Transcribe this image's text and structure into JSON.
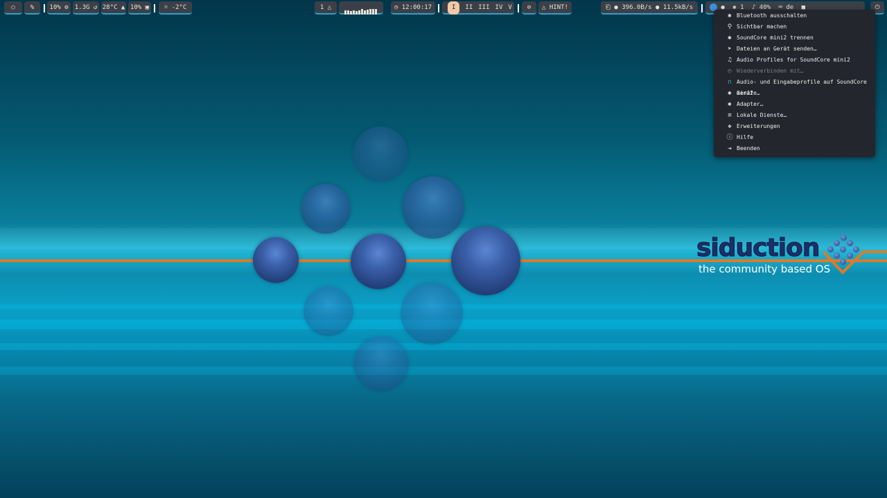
{
  "topbar": {
    "left": {
      "icon1": "drop-icon",
      "icon2": "percent-icon",
      "cpu_label": "10%",
      "mem_label": "1.3G",
      "temp_label": "28°C",
      "disk_label": "10%",
      "weather_label": "-2°C"
    },
    "center": {
      "notifications_label": "1",
      "workspaces": [
        "I",
        "II",
        "III",
        "IV",
        "V"
      ],
      "active_workspace": "I",
      "clock": "12:00:17",
      "hint_label": "HINT!"
    },
    "right": {
      "net_down": "396.0B/s",
      "net_up": "11.5kB/s",
      "bt_count": "1",
      "volume": "40%",
      "keyboard_layout": "de"
    }
  },
  "menu": {
    "items": [
      {
        "label": "Bluetooth ausschalten",
        "icon": "bluetooth-off-icon",
        "enabled": true
      },
      {
        "label": "Sichtbar machen",
        "icon": "search-icon",
        "enabled": true
      },
      {
        "label": "SoundCore mini2 trennen",
        "icon": "bluetooth-off-icon",
        "enabled": true
      },
      {
        "label": "Dateien an Gerät senden…",
        "icon": "send-icon",
        "enabled": true
      },
      {
        "label": "Audio Profiles for SoundCore mini2",
        "icon": "music-icon",
        "enabled": true
      },
      {
        "label": "Wiederverbinden mit…",
        "icon": "reconnect-icon",
        "enabled": false
      },
      {
        "label": "Audio- und Eingabeprofile auf SoundCore mini2",
        "icon": "headphones-icon",
        "enabled": true
      },
      {
        "label": "Geräte…",
        "icon": "bluetooth-icon",
        "enabled": true
      },
      {
        "label": "Adapter…",
        "icon": "bluetooth-icon",
        "enabled": true
      },
      {
        "label": "Lokale Dienste…",
        "icon": "list-icon",
        "enabled": true
      },
      {
        "label": "Erweiterungen",
        "icon": "puzzle-icon",
        "enabled": true
      },
      {
        "label": "Hilfe",
        "icon": "info-icon",
        "enabled": true
      },
      {
        "label": "Beenden",
        "icon": "exit-icon",
        "enabled": true
      }
    ]
  },
  "wallpaper": {
    "logo_word": "siduction",
    "tagline": "the community based OS",
    "accent_color": "#e07a25"
  }
}
